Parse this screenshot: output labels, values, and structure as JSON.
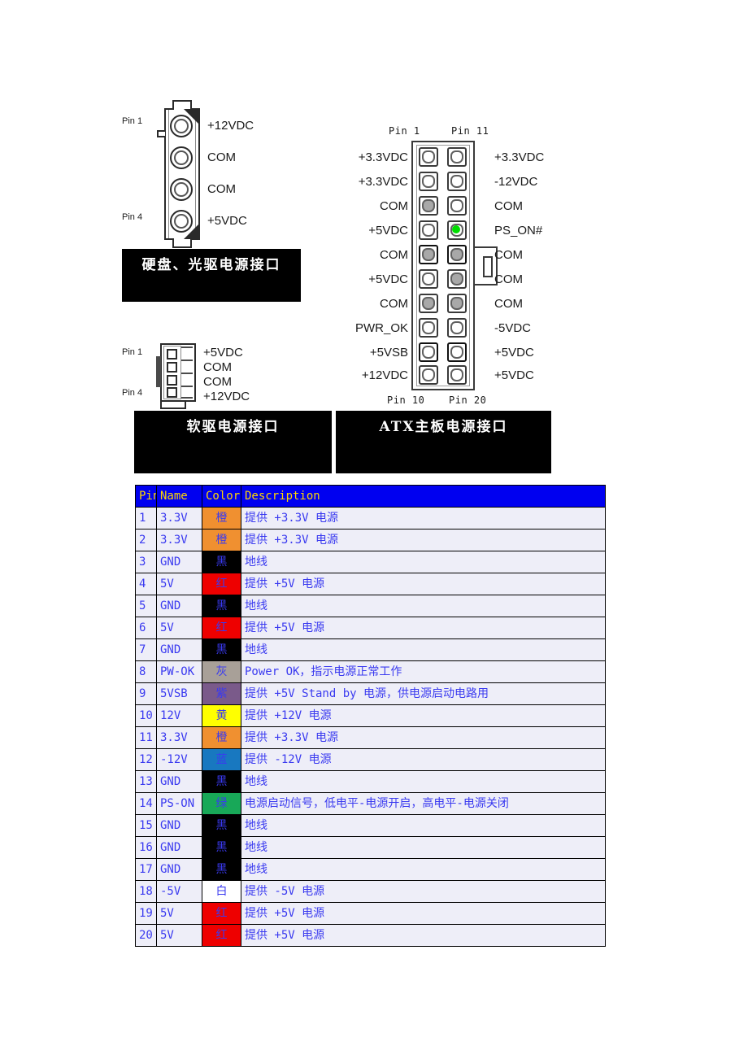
{
  "diagrams": {
    "hdd": {
      "name": "hard-disk-optical-drive-power-connector",
      "caption": "硬盘、光驱电源接口",
      "pin_first": "Pin 1",
      "pin_last": "Pin 4",
      "signals": [
        "+12VDC",
        "COM",
        "COM",
        "+5VDC"
      ]
    },
    "floppy": {
      "name": "floppy-drive-power-connector",
      "caption": "软驱电源接口",
      "pin_first": "Pin 1",
      "pin_last": "Pin 4",
      "signals": [
        "+5VDC",
        "COM",
        "COM",
        "+12VDC"
      ]
    },
    "atx": {
      "name": "atx-motherboard-power-connector",
      "caption": "ATX主板电源接口",
      "pin_top_left": "Pin 1",
      "pin_top_right": "Pin 11",
      "pin_bottom_left": "Pin 10",
      "pin_bottom_right": "Pin 20",
      "left_signals": [
        "+3.3VDC",
        "+3.3VDC",
        "COM",
        "+5VDC",
        "COM",
        "+5VDC",
        "COM",
        "PWR_OK",
        "+5VSB",
        "+12VDC"
      ],
      "right_signals": [
        "+3.3VDC",
        "-12VDC",
        "COM",
        "PS_ON#",
        "COM",
        "COM",
        "COM",
        "-5VDC",
        "+5VDC",
        "+5VDC"
      ],
      "highlight_pin": "PS_ON#",
      "highlight_color": "#00dd00"
    }
  },
  "table": {
    "headers": [
      "Pin",
      "Name",
      "Color",
      "Description"
    ],
    "header_bg": "#0000f0",
    "header_fg": "#ffd700",
    "row_bg": "#eeeef8",
    "row_fg": "#3a3af0",
    "rows": [
      {
        "pin": "1",
        "name": "3.3V",
        "color": "橙",
        "swatch": "#f09030",
        "desc": "提供 +3.3V 电源"
      },
      {
        "pin": "2",
        "name": "3.3V",
        "color": "橙",
        "swatch": "#f09030",
        "desc": "提供 +3.3V 电源"
      },
      {
        "pin": "3",
        "name": "GND",
        "color": "黑",
        "swatch": "#000000",
        "desc": "地线"
      },
      {
        "pin": "4",
        "name": "5V",
        "color": "红",
        "swatch": "#ee0000",
        "desc": "提供 +5V 电源"
      },
      {
        "pin": "5",
        "name": "GND",
        "color": "黑",
        "swatch": "#000000",
        "desc": "地线"
      },
      {
        "pin": "6",
        "name": "5V",
        "color": "红",
        "swatch": "#ee0000",
        "desc": "提供 +5V 电源"
      },
      {
        "pin": "7",
        "name": "GND",
        "color": "黑",
        "swatch": "#000000",
        "desc": "地线"
      },
      {
        "pin": "8",
        "name": "PW-OK",
        "color": "灰",
        "swatch": "#a8a098",
        "desc": "Power OK，指示电源正常工作"
      },
      {
        "pin": "9",
        "name": "5VSB",
        "color": "紫",
        "swatch": "#7a5a8a",
        "desc": "提供 +5V Stand by 电源，供电源启动电路用"
      },
      {
        "pin": "10",
        "name": "12V",
        "color": "黄",
        "swatch": "#ffff00",
        "desc": "提供 +12V 电源"
      },
      {
        "pin": "11",
        "name": "3.3V",
        "color": "橙",
        "swatch": "#f09030",
        "desc": "提供 +3.3V 电源"
      },
      {
        "pin": "12",
        "name": "-12V",
        "color": "蓝",
        "swatch": "#1878c0",
        "desc": "提供 -12V 电源"
      },
      {
        "pin": "13",
        "name": "GND",
        "color": "黑",
        "swatch": "#000000",
        "desc": "地线"
      },
      {
        "pin": "14",
        "name": "PS-ON",
        "color": "绿",
        "swatch": "#18a858",
        "desc": "电源启动信号，低电平-电源开启，高电平-电源关闭"
      },
      {
        "pin": "15",
        "name": "GND",
        "color": "黑",
        "swatch": "#000000",
        "desc": "地线"
      },
      {
        "pin": "16",
        "name": "GND",
        "color": "黑",
        "swatch": "#000000",
        "desc": "地线"
      },
      {
        "pin": "17",
        "name": "GND",
        "color": "黑",
        "swatch": "#000000",
        "desc": "地线"
      },
      {
        "pin": "18",
        "name": "-5V",
        "color": "白",
        "swatch": "#ffffff",
        "desc": "提供 -5V 电源"
      },
      {
        "pin": "19",
        "name": "5V",
        "color": "红",
        "swatch": "#ee0000",
        "desc": "提供 +5V 电源"
      },
      {
        "pin": "20",
        "name": "5V",
        "color": "红",
        "swatch": "#ee0000",
        "desc": "提供 +5V 电源"
      }
    ]
  }
}
